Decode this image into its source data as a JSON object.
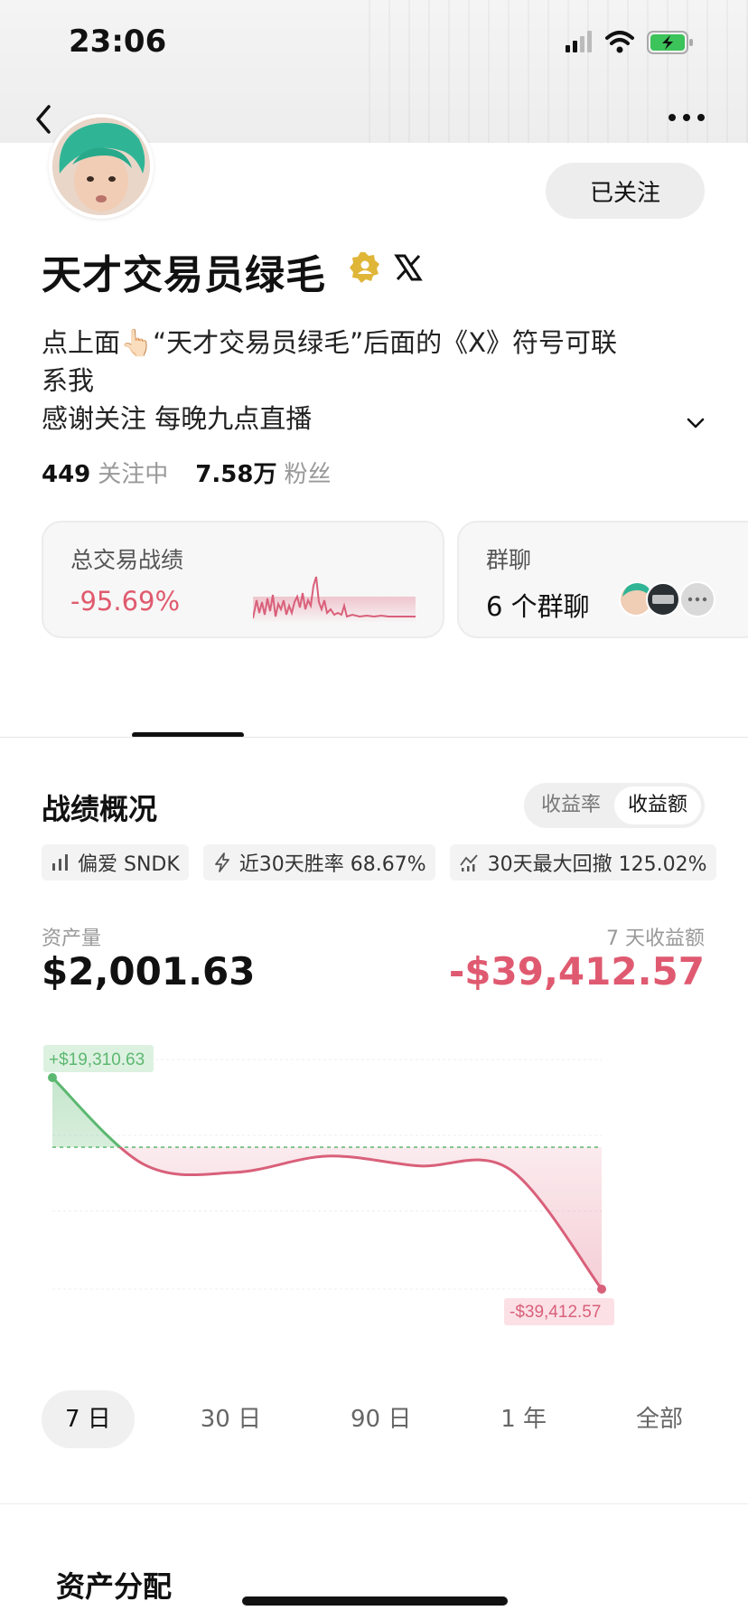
{
  "status_bar": {
    "time": "23:06"
  },
  "profile": {
    "follow_button": "已关注",
    "name": "天才交易员绿毛",
    "bio_lines": [
      "点上面👆🏻“天才交易员绿毛”后面的《X》符号可联",
      "系我",
      "感谢关注 每晚九点直播"
    ],
    "following_count": "449",
    "following_label": "关注中",
    "followers_count": "7.58万",
    "followers_label": "粉丝"
  },
  "cards": {
    "performance": {
      "title": "总交易战绩",
      "value": "-95.69%"
    },
    "group_chat": {
      "title": "群聊",
      "value": "6 个群聊"
    }
  },
  "overview": {
    "title": "战绩概况",
    "toggle": [
      "收益率",
      "收益额"
    ],
    "toggle_active": "收益额",
    "chips": [
      "偏爱 SNDK",
      "近30天胜率 68.67%",
      "30天最大回撤 125.02%"
    ],
    "asset_label": "资产量",
    "asset_value": "$2,001.63",
    "pnl_label": "7 天收益额",
    "pnl_value": "-$39,412.57"
  },
  "chart_data": {
    "type": "line",
    "x": [
      0,
      1,
      2,
      3,
      4,
      5,
      6
    ],
    "values": [
      19310.63,
      -4800,
      -7000,
      -2500,
      -5200,
      -6200,
      -39412.57
    ],
    "annotations": [
      "+$19,310.63",
      "-$39,412.57"
    ],
    "baseline": 0,
    "positive_color": "#5cb870",
    "negative_color": "#d9607a"
  },
  "periods": [
    "7 日",
    "30 日",
    "90 日",
    "1 年",
    "全部"
  ],
  "period_active": "7 日",
  "allocation": {
    "title": "资产分配"
  },
  "colors": {
    "negative": "#df5a70",
    "positive": "#5cb870"
  }
}
